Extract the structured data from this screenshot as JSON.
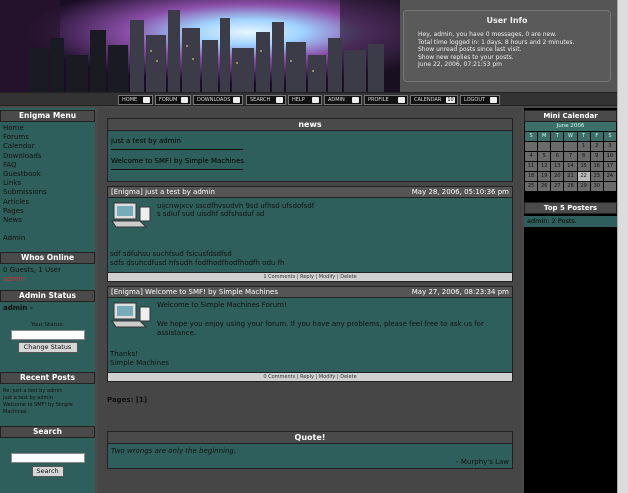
{
  "userinfo": {
    "title": "User Info",
    "line1": "Hey, admin, you have 0 messages, 0 are new.",
    "line2": "Total time logged in: 1 days, 8 hours and 2 minutes.",
    "line3": "Show unread posts since last visit.",
    "line4": "Show new replies to your posts.",
    "line5": "June 22, 2006, 07:21:53 pm"
  },
  "nav": [
    "HOME",
    "FORUM",
    "DOWNLOADS",
    "SEARCH",
    "HELP",
    "ADMIN",
    "PROFILE",
    "CALENDAR",
    "LOGOUT"
  ],
  "calendar_badge": "10",
  "left": {
    "menu_title": "Enigma Menu",
    "menu": [
      "Home",
      "Forums",
      "Calendar",
      "Downloads",
      "FAQ",
      "Guestbook",
      "Links",
      "Submissions",
      "Articles",
      "Pages",
      "News",
      "",
      "Admin"
    ],
    "online_title": "Whos Online",
    "online_line": "0 Guests, 1 User",
    "online_user": "admin",
    "admin_title": "Admin Status",
    "admin_user": "admin -",
    "your_status": "Your Status:",
    "change_status": "Change Status",
    "recent_title": "Recent Posts",
    "recent": [
      "Re: just a test by admin",
      "just a test by admin",
      "Welcome to SMF! by Simple",
      "Machines"
    ],
    "search_title": "Search",
    "search_btn": "Search"
  },
  "news": {
    "title": "news",
    "line1": "just a test by admin",
    "line2": "Welcome to SMF! by Simple Machines"
  },
  "post1": {
    "title": "[Enigma] just a test by admin",
    "date": "May 28, 2006, 05:10:36 pm",
    "l1": "uijcnwjxcv   sscdfhvsudvh   9sd ufhsd ufsdofsdf",
    "l2": "s sdiuf sud    uisdhf sdfshsduf    sd",
    "l3": "sdf   sdfuhsu    suchfsud fsicusfdsdfsd",
    "l4": "sdfs dsuhcdfusd hfsudh fodfhodfhodfhodfh odu fh",
    "foot": "1 Comments | Reply | Modify | Delete"
  },
  "post2": {
    "title": "[Enigma] Welcome to SMF! by Simple Machines",
    "date": "May 27, 2006, 08:23:34 pm",
    "l1": "Welcome to Simple Machines Forum!",
    "l2": "We hope you enjoy using your forum.  If you have any problems, please feel free to ask us for",
    "l3": "assistance.",
    "l4": "Thanks!",
    "l5": "Simple Machines",
    "foot": "0 Comments | Reply | Modify | Delete"
  },
  "pages": "Pages: [1]",
  "quote": {
    "title": "Quote!",
    "text": "Two wrongs are only the beginning.",
    "author": "- Murphy's Law"
  },
  "right": {
    "cal_title": "Mini Calendar",
    "cal_month": "June 2006",
    "dow": [
      "S",
      "M",
      "T",
      "W",
      "T",
      "F",
      "S"
    ],
    "weeks": [
      [
        "",
        "",
        "",
        "",
        "1",
        "2",
        "3"
      ],
      [
        "4",
        "5",
        "6",
        "7",
        "8",
        "9",
        "10"
      ],
      [
        "11",
        "12",
        "13",
        "14",
        "15",
        "16",
        "17"
      ],
      [
        "18",
        "19",
        "20",
        "21",
        "22",
        "23",
        "24"
      ],
      [
        "25",
        "26",
        "27",
        "28",
        "29",
        "30",
        ""
      ]
    ],
    "posters_title": "Top 5 Posters",
    "poster": "admin: 2 Posts."
  }
}
